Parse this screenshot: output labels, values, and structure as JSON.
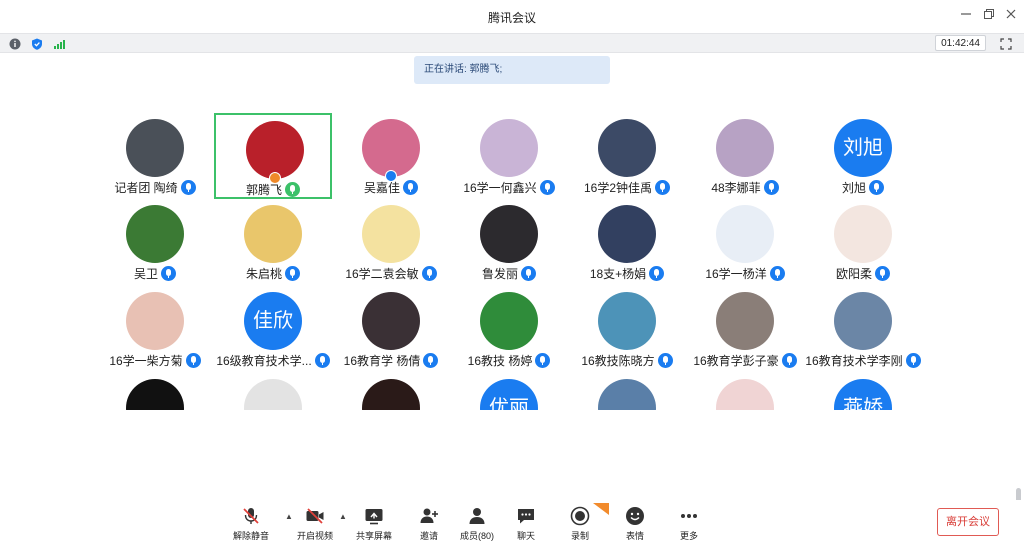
{
  "app": {
    "title": "腾讯会议"
  },
  "infobar": {
    "timer": "01:42:44"
  },
  "speaking": {
    "label": "正在讲话: 郭腾飞;"
  },
  "participants": [
    {
      "name": "记者团 陶绮",
      "avatar_text": "",
      "avatar_color": "#4a5058",
      "mic": "blue"
    },
    {
      "name": "郭腾飞",
      "avatar_text": "",
      "avatar_color": "#b9202a",
      "mic": "green",
      "active": true,
      "badge": "host"
    },
    {
      "name": "吴嘉佳",
      "avatar_text": "",
      "avatar_color": "#d46a8e",
      "mic": "blue",
      "badge": "cohost"
    },
    {
      "name": "16学一何鑫兴",
      "avatar_text": "",
      "avatar_color": "#c9b4d6",
      "mic": "blue"
    },
    {
      "name": "16学2钟佳禹",
      "avatar_text": "",
      "avatar_color": "#3c4a66",
      "mic": "blue"
    },
    {
      "name": "48李娜菲",
      "avatar_text": "",
      "avatar_color": "#b7a2c4",
      "mic": "blue"
    },
    {
      "name": "刘旭",
      "avatar_text": "刘旭",
      "avatar_color": "#1a7cf0",
      "mic": "blue"
    },
    {
      "name": "吴卫",
      "avatar_text": "",
      "avatar_color": "#3b7a34",
      "mic": "blue"
    },
    {
      "name": "朱启桃",
      "avatar_text": "",
      "avatar_color": "#e9c66b",
      "mic": "blue"
    },
    {
      "name": "16学二袁会敏",
      "avatar_text": "",
      "avatar_color": "#f4e2a0",
      "mic": "blue"
    },
    {
      "name": "鲁发丽",
      "avatar_text": "",
      "avatar_color": "#2c2a2e",
      "mic": "blue"
    },
    {
      "name": "18支+杨娟",
      "avatar_text": "",
      "avatar_color": "#324060",
      "mic": "blue"
    },
    {
      "name": "16学一杨洋",
      "avatar_text": "",
      "avatar_color": "#e8eef6",
      "mic": "blue"
    },
    {
      "name": "欧阳柔",
      "avatar_text": "",
      "avatar_color": "#f3e6e0",
      "mic": "blue"
    },
    {
      "name": "16学一柴方菊",
      "avatar_text": "",
      "avatar_color": "#e8c1b4",
      "mic": "blue"
    },
    {
      "name": "16级教育技术学...",
      "avatar_text": "佳欣",
      "avatar_color": "#1a7cf0",
      "mic": "blue"
    },
    {
      "name": "16教育学 杨倩",
      "avatar_text": "",
      "avatar_color": "#3a3035",
      "mic": "blue"
    },
    {
      "name": "16教技 杨婷",
      "avatar_text": "",
      "avatar_color": "#2f8c3a",
      "mic": "blue"
    },
    {
      "name": "16教技陈晓方",
      "avatar_text": "",
      "avatar_color": "#4d93b8",
      "mic": "blue"
    },
    {
      "name": "16教育学彭子豪",
      "avatar_text": "",
      "avatar_color": "#8a7e78",
      "mic": "blue"
    },
    {
      "name": "16教育技术学李刚",
      "avatar_text": "",
      "avatar_color": "#6b86a6",
      "mic": "blue"
    },
    {
      "name": "",
      "avatar_text": "",
      "avatar_color": "#111111",
      "mic": ""
    },
    {
      "name": "",
      "avatar_text": "",
      "avatar_color": "#e3e3e3",
      "mic": ""
    },
    {
      "name": "",
      "avatar_text": "",
      "avatar_color": "#2a1a18",
      "mic": ""
    },
    {
      "name": "",
      "avatar_text": "优丽",
      "avatar_color": "#1a7cf0",
      "mic": ""
    },
    {
      "name": "",
      "avatar_text": "",
      "avatar_color": "#5a7fa8",
      "mic": ""
    },
    {
      "name": "",
      "avatar_text": "",
      "avatar_color": "#f0d4d4",
      "mic": ""
    },
    {
      "name": "",
      "avatar_text": "燕娇",
      "avatar_color": "#1a7cf0",
      "mic": ""
    }
  ],
  "toolbar": {
    "unmute": "解除静音",
    "video": "开启视频",
    "share": "共享屏幕",
    "invite": "邀请",
    "members": "成员(80)",
    "chat": "聊天",
    "record": "录制",
    "reaction": "表情",
    "more": "更多",
    "leave": "离开会议"
  },
  "colors": {
    "accent": "#1a7cf0",
    "active_border": "#3cc169",
    "leave_red": "#d83b35"
  }
}
